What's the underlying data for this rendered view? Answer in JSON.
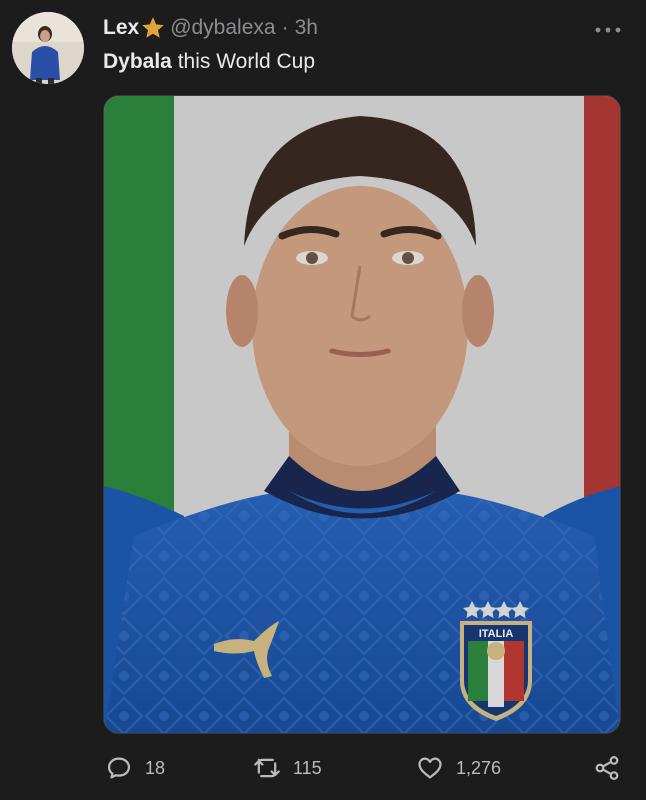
{
  "tweet": {
    "display_name": "Lex",
    "handle": "@dybalexa",
    "separator": "·",
    "time": "3h",
    "text_bold": "Dybala",
    "text_rest": " this World Cup"
  },
  "media": {
    "badge_text": "ITALIA"
  },
  "actions": {
    "replies": "18",
    "retweets": "115",
    "likes": "1,276"
  },
  "icons": {
    "verified": "star-icon",
    "more": "more-icon",
    "reply": "reply-icon",
    "retweet": "retweet-icon",
    "like": "heart-icon",
    "share": "share-icon"
  },
  "colors": {
    "background": "#1c1c1c",
    "text": "#e7e9ea",
    "secondary": "#8b8e91",
    "star": "#e0a53a",
    "flag_green": "#2e8b3f",
    "flag_white": "#dadada",
    "flag_red": "#b43a35",
    "jersey": "#1f5cb3"
  }
}
